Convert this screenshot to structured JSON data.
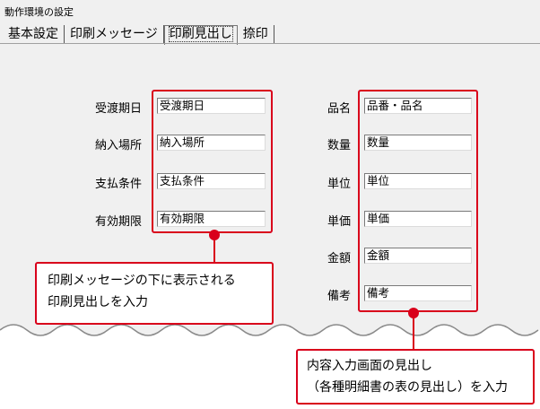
{
  "window": {
    "title": "動作環境の設定"
  },
  "tabs": [
    {
      "label": "基本設定",
      "active": false
    },
    {
      "label": "印刷メッセージ",
      "active": false
    },
    {
      "label": "印刷見出し",
      "active": true
    },
    {
      "label": "捺印",
      "active": false
    }
  ],
  "left_fields": [
    {
      "label": "受渡期日",
      "value": "受渡期日"
    },
    {
      "label": "納入場所",
      "value": "納入場所"
    },
    {
      "label": "支払条件",
      "value": "支払条件"
    },
    {
      "label": "有効期限",
      "value": "有効期限"
    }
  ],
  "right_fields": [
    {
      "label": "品名",
      "value": "品番・品名"
    },
    {
      "label": "数量",
      "value": "数量"
    },
    {
      "label": "単位",
      "value": "単位"
    },
    {
      "label": "単価",
      "value": "単価"
    },
    {
      "label": "金額",
      "value": "金額"
    },
    {
      "label": "備考",
      "value": "備考"
    }
  ],
  "callout_left": {
    "line1": "印刷メッセージの下に表示される",
    "line2": "印刷見出しを入力"
  },
  "callout_right": {
    "line1": "内容入力画面の見出し",
    "line2": "（各種明細書の表の見出し）を入力"
  },
  "colors": {
    "accent": "#d9001b",
    "window_bg": "#f0f0f0"
  }
}
